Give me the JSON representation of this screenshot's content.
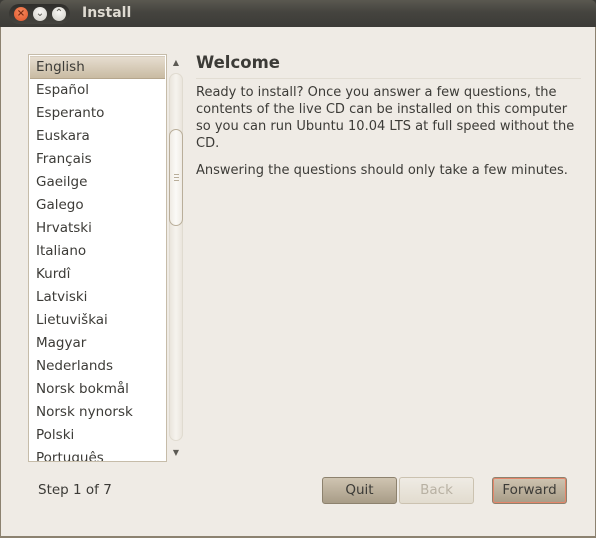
{
  "window": {
    "title": "Install",
    "controls": {
      "close_icon": "×",
      "minimize_icon": "⌄",
      "maximize_icon": "⌃"
    }
  },
  "language_list": {
    "items": [
      "English",
      "Español",
      "Esperanto",
      "Euskara",
      "Français",
      "Gaeilge",
      "Galego",
      "Hrvatski",
      "Italiano",
      "Kurdî",
      "Latviski",
      "Lietuviškai",
      "Magyar",
      "Nederlands",
      "Norsk bokmål",
      "Norsk nynorsk",
      "Polski",
      "Português"
    ],
    "selected": "English",
    "scroll_up_icon": "▲",
    "scroll_down_icon": "▼"
  },
  "welcome": {
    "heading": "Welcome",
    "paragraph1": "Ready to install?  Once you answer a few questions, the contents of the live CD can be installed on this computer so you can run Ubuntu 10.04 LTS at full speed without the CD.",
    "paragraph2": "Answering the questions should only take a few minutes."
  },
  "footer": {
    "step_label": "Step 1 of 7",
    "quit_label": "Quit",
    "back_label": "Back",
    "forward_label": "Forward"
  }
}
